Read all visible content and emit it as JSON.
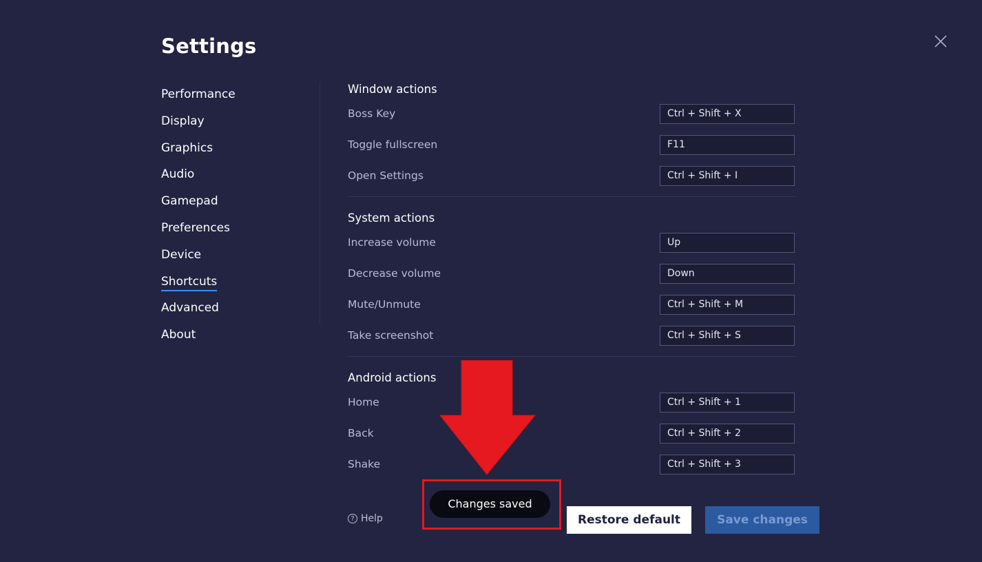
{
  "header": {
    "title": "Settings",
    "close_icon": "close-icon"
  },
  "sidebar": {
    "items": [
      {
        "label": "Performance"
      },
      {
        "label": "Display"
      },
      {
        "label": "Graphics"
      },
      {
        "label": "Audio"
      },
      {
        "label": "Gamepad"
      },
      {
        "label": "Preferences"
      },
      {
        "label": "Device"
      },
      {
        "label": "Shortcuts",
        "active": true
      },
      {
        "label": "Advanced"
      },
      {
        "label": "About"
      }
    ]
  },
  "sections": [
    {
      "title": "Window actions",
      "rows": [
        {
          "label": "Boss Key",
          "value": "Ctrl + Shift + X"
        },
        {
          "label": "Toggle fullscreen",
          "value": "F11"
        },
        {
          "label": "Open Settings",
          "value": "Ctrl + Shift + I"
        }
      ]
    },
    {
      "title": "System actions",
      "rows": [
        {
          "label": "Increase volume",
          "value": "Up"
        },
        {
          "label": "Decrease volume",
          "value": "Down"
        },
        {
          "label": "Mute/Unmute",
          "value": "Ctrl + Shift + M"
        },
        {
          "label": "Take screenshot",
          "value": "Ctrl + Shift + S"
        }
      ]
    },
    {
      "title": "Android actions",
      "rows": [
        {
          "label": "Home",
          "value": "Ctrl + Shift + 1"
        },
        {
          "label": "Back",
          "value": "Ctrl + Shift + 2"
        },
        {
          "label": "Shake",
          "value": "Ctrl + Shift + 3"
        }
      ]
    }
  ],
  "footer": {
    "help_label": "Help",
    "help_icon": "question-circle-icon",
    "toast": "Changes saved",
    "restore_label": "Restore default",
    "save_label": "Save changes"
  },
  "annotation": {
    "arrow_icon": "red-down-arrow",
    "color": "#e5191f"
  }
}
